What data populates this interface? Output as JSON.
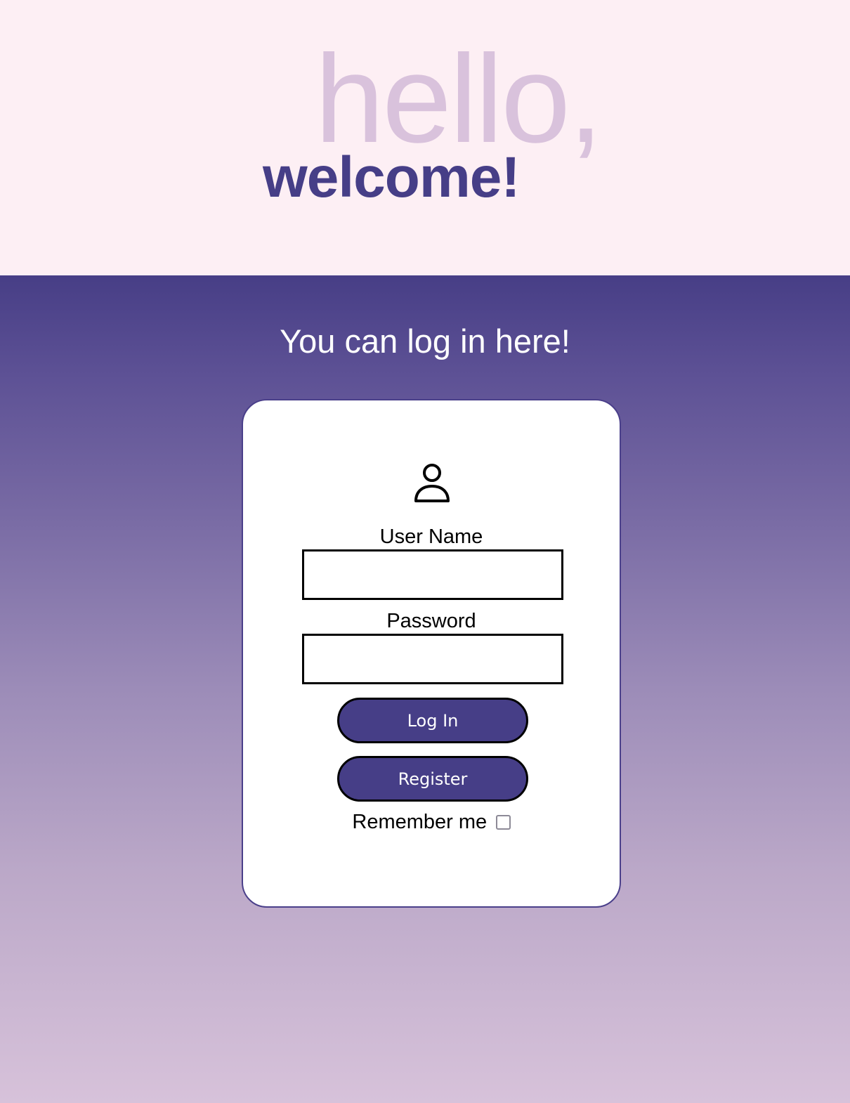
{
  "hero": {
    "greeting": "hello,",
    "welcome": "welcome!"
  },
  "login": {
    "tagline": "You can log in here!",
    "icon": "user-icon",
    "username_label": "User Name",
    "username_value": "",
    "password_label": "Password",
    "password_value": "",
    "login_button": "Log In",
    "register_button": "Register",
    "remember_label": "Remember me",
    "remember_checked": false
  },
  "colors": {
    "hero_background": "#fdeff4",
    "greeting_color": "#d9c2dc",
    "brand_purple": "#463e87",
    "gradient_end": "#d7c2da"
  }
}
